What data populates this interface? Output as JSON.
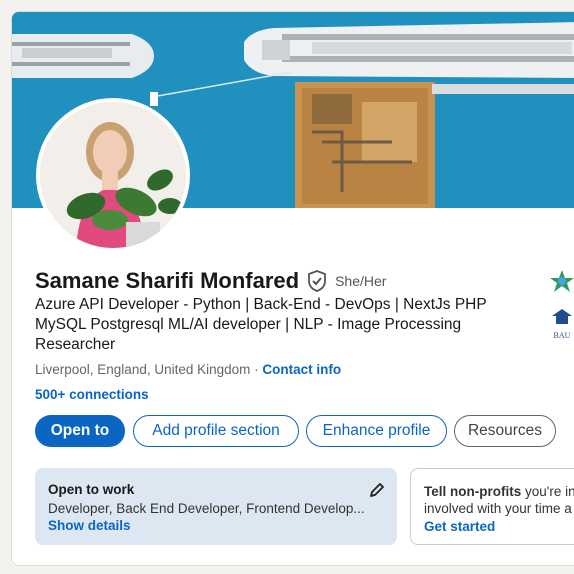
{
  "profile": {
    "name": "Samane Sharifi Monfared",
    "pronouns": "She/Her",
    "headline": "Azure API Developer - Python | Back-End - DevOps | NextJs PHP MySQL Postgresql ML/AI developer | NLP - Image Processing Researcher",
    "location": "Liverpool, England, United Kingdom",
    "separator": " · ",
    "contact_label": "Contact info",
    "connections": "500+ connections"
  },
  "buttons": {
    "open_to": "Open to",
    "add_section": "Add profile section",
    "enhance": "Enhance profile",
    "resources": "Resources"
  },
  "open_to_work": {
    "title": "Open to work",
    "roles": "Developer, Back End Developer, Frontend Develop...",
    "link": "Show details"
  },
  "nonprofit": {
    "bold": "Tell non-profits",
    "line1_rest": " you're int",
    "line2": "involved with your time a",
    "link": "Get started"
  },
  "side": {
    "logo2_text": "BAU"
  },
  "colors": {
    "brand_blue": "#0a66c2",
    "banner_sea": "#1b8ab8",
    "open_to_work_bg": "#dde7f1"
  }
}
